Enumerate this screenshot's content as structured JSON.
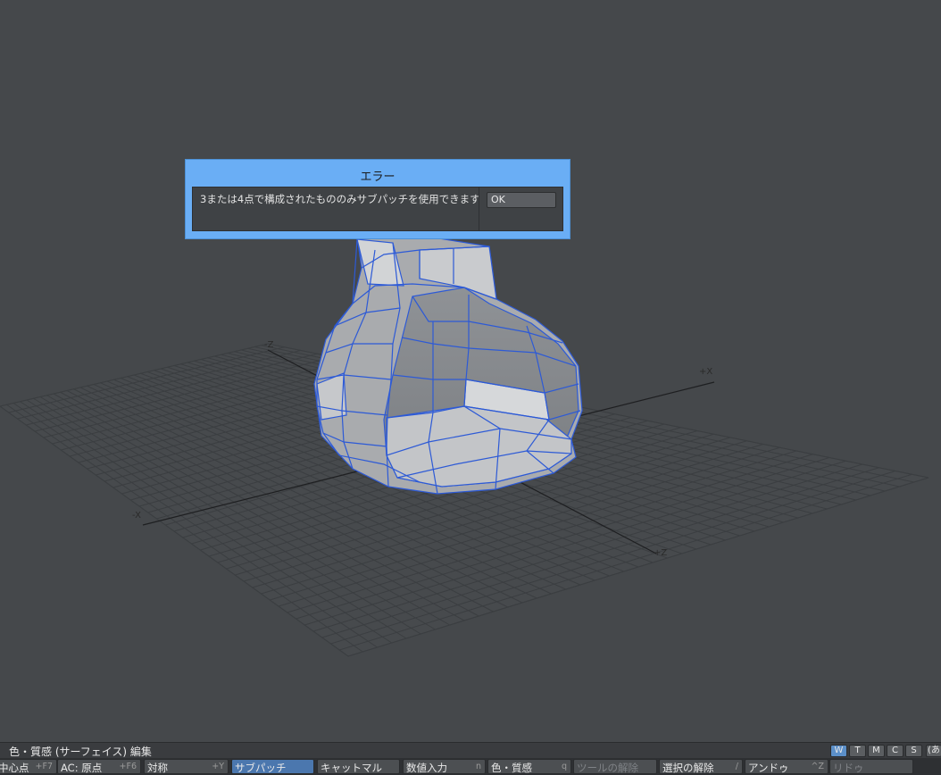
{
  "dialog": {
    "title": "エラー",
    "message": "3または4点で構成されたもののみサブパッチを使用できます",
    "ok_label": "OK"
  },
  "viewport": {
    "axis_labels": {
      "neg_z": "-Z",
      "pos_x": "+X",
      "neg_x": "-X",
      "pos_z": "+Z"
    }
  },
  "status_bar": {
    "text": "色・質感 (サーフェイス) 編集",
    "view_buttons": [
      {
        "label": "W",
        "active": true
      },
      {
        "label": "T",
        "active": false
      },
      {
        "label": "M",
        "active": false
      },
      {
        "label": "C",
        "active": false
      },
      {
        "label": "S",
        "active": false
      },
      {
        "label": "(あ",
        "active": false
      }
    ]
  },
  "command_bar": {
    "buttons": [
      {
        "label": "中心点",
        "shortcut": "+F7"
      },
      {
        "label": "AC: 原点",
        "shortcut": "+F6"
      },
      {
        "label": "対称",
        "shortcut": "+Y"
      },
      {
        "label": "サブパッチ",
        "shortcut": "",
        "active": true
      },
      {
        "label": "キャットマル",
        "shortcut": ""
      },
      {
        "label": "数値入力",
        "shortcut": "n"
      },
      {
        "label": "色・質感",
        "shortcut": "q"
      },
      {
        "label": "ツールの解除",
        "shortcut": "",
        "disabled": true
      },
      {
        "label": "選択の解除",
        "shortcut": "/"
      },
      {
        "label": "アンドゥ",
        "shortcut": "^Z"
      },
      {
        "label": "リドゥ",
        "shortcut": "",
        "disabled": true
      }
    ]
  },
  "colors": {
    "background": "#45484b",
    "dialog_title_bar": "#6aaef5",
    "wire": "#2d5ad6",
    "active_button": "#4b77ae"
  }
}
